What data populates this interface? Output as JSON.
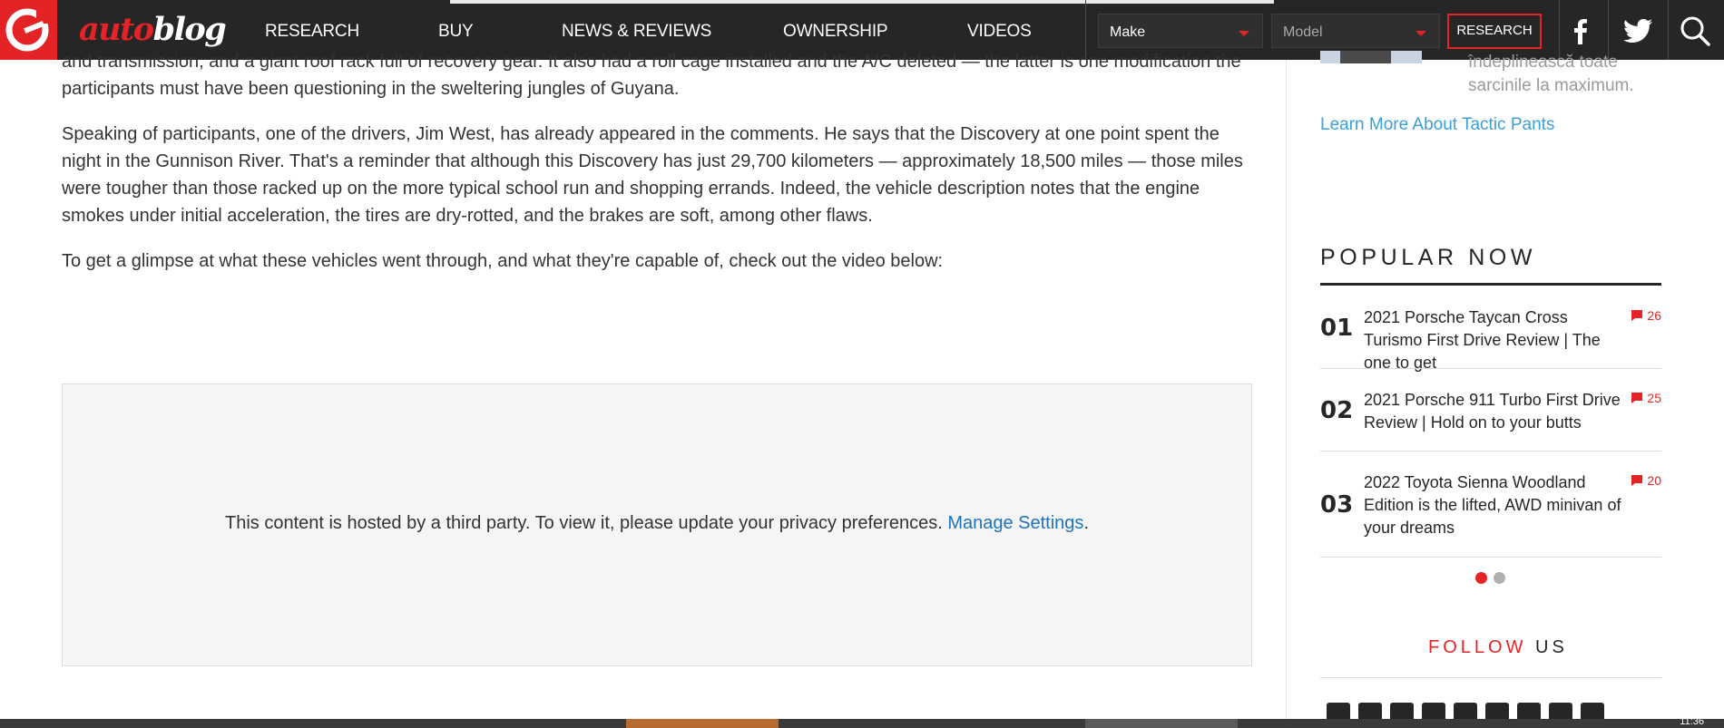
{
  "header": {
    "logo": {
      "text_auto": "auto",
      "text_blog": "blog",
      "brand_color": "#e32326"
    },
    "nav": [
      {
        "label": "RESEARCH"
      },
      {
        "label": "BUY"
      },
      {
        "label": "NEWS & REVIEWS"
      },
      {
        "label": "OWNERSHIP"
      },
      {
        "label": "VIDEOS"
      }
    ],
    "make_select": {
      "value": "Make"
    },
    "model_select": {
      "value": "Model"
    },
    "research_button": "RESEARCH",
    "icons": [
      "facebook-icon",
      "twitter-icon",
      "search-icon"
    ]
  },
  "article": {
    "paragraphs": [
      "and transmission; and a giant roof rack full of recovery gear. It also had a roll cage installed and the A/C deleted — the latter is one modification the participants must have been questioning in the sweltering jungles of Guyana.",
      "Speaking of participants, one of the drivers, Jim West, has already appeared in the comments. He says that the Discovery at one point spent the night in the Gunnison River. That's a reminder that although this Discovery has just 29,700 kilometers — approximately 18,500 miles — those miles were tougher than those racked up on the more typical school run and shopping errands. Indeed, the vehicle description notes that the engine smokes under initial acceleration, the tires are dry-rotted, and the brakes are soft, among other flaws.",
      "To get a glimpse at what these vehicles went through, and what they're capable of, check out the video below:"
    ],
    "embed": {
      "message": "This content is hosted by a third party. To view it, please update your privacy preferences.",
      "link": "Manage Settings",
      "suffix": "."
    }
  },
  "sidebar": {
    "ad": {
      "text": "îndeplinească toate sarcinile la maximum.",
      "link": "Learn More About Tactic Pants"
    },
    "popular_title": "POPULAR NOW",
    "popular_items": [
      {
        "num": "01",
        "title": "2021 Porsche Taycan Cross Turismo First Drive Review | The one to get",
        "comments": "26"
      },
      {
        "num": "02",
        "title": "2021 Porsche 911 Turbo First Drive Review | Hold on to your butts",
        "comments": "25"
      },
      {
        "num": "03",
        "title": "2022 Toyota Sienna Woodland Edition is the lifted, AWD minivan of your dreams",
        "comments": "20"
      }
    ],
    "carousel": {
      "pages": 2,
      "active": 1
    },
    "follow": {
      "word1": "FOLLOW",
      "word2": "US"
    }
  },
  "taskbar": {
    "clock": "11:36"
  }
}
